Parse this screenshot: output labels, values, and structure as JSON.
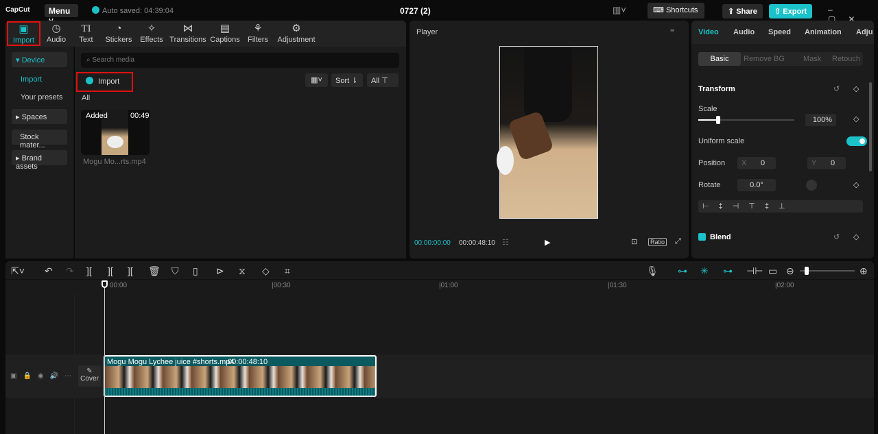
{
  "app": {
    "logo": "CapCut",
    "menu": "Menu",
    "autosave": "Auto saved: 04:39:04",
    "project_title": "0727 (2)",
    "shortcuts": "Shortcuts",
    "share": "Share",
    "export": "Export"
  },
  "tabs": [
    {
      "label": "Import",
      "icon": "▣"
    },
    {
      "label": "Audio",
      "icon": "◷"
    },
    {
      "label": "Text",
      "icon": "TI"
    },
    {
      "label": "Stickers",
      "icon": "◔"
    },
    {
      "label": "Effects",
      "icon": "✧"
    },
    {
      "label": "Transitions",
      "icon": "⋈"
    },
    {
      "label": "Captions",
      "icon": "▤"
    },
    {
      "label": "Filters",
      "icon": "⚘"
    },
    {
      "label": "Adjustment",
      "icon": "⚙"
    }
  ],
  "sidebar": {
    "device": "Device",
    "import": "Import",
    "presets": "Your presets",
    "spaces": "Spaces",
    "stock": "Stock mater...",
    "brand": "Brand assets"
  },
  "media": {
    "search_placeholder": "Search media",
    "import_btn": "Import",
    "sort": "Sort",
    "all_filter": "All",
    "all_label": "All",
    "item": {
      "badge": "Added",
      "duration": "00:49",
      "name": "Mogu Mo...rts.mp4"
    }
  },
  "player": {
    "title": "Player",
    "current": "00:00:00:00",
    "total": "00:00:48:10",
    "ratio": "Ratio"
  },
  "right": {
    "tabs": [
      "Video",
      "Audio",
      "Speed",
      "Animation",
      "Adju"
    ],
    "subtabs": [
      "Basic",
      "Remove BG",
      "Mask",
      "Retouch"
    ],
    "transform": "Transform",
    "scale_label": "Scale",
    "scale_value": "100%",
    "scale_percent": 100,
    "uniform": "Uniform scale",
    "uniform_on": true,
    "position": "Position",
    "x_label": "X",
    "x": "0",
    "y_label": "Y",
    "y": "0",
    "rotate": "Rotate",
    "rotate_value": "0.0°",
    "blend": "Blend"
  },
  "timeline": {
    "ticks": [
      "00:00",
      "|00:30",
      "|01:00",
      "|01:30",
      "|02:00"
    ],
    "cover": "Cover",
    "clip_name": "Mogu Mogu Lychee juice #shorts.mp4",
    "clip_duration": "00:00:48:10"
  },
  "colors": {
    "accent": "#1bc2c9",
    "highlight": "#e01010",
    "clip": "#0b5a5f"
  }
}
